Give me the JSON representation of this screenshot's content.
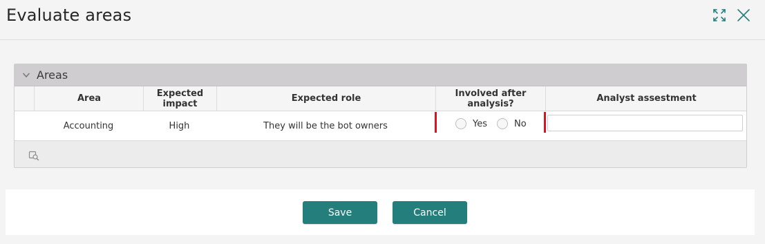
{
  "dialog": {
    "title": "Evaluate areas"
  },
  "panel": {
    "title": "Areas"
  },
  "table": {
    "columns": [
      "Area",
      "Expected impact",
      "Expected role",
      "Involved after analysis?",
      "Analyst assestment"
    ],
    "rows": [
      {
        "area": "Accounting",
        "impact": "High",
        "role": "They will be the bot owners",
        "involved_options": [
          "Yes",
          "No"
        ],
        "involved_selected": null,
        "assessment_value": ""
      }
    ]
  },
  "actions": {
    "save_label": "Save",
    "cancel_label": "Cancel"
  },
  "colors": {
    "accent": "#247e7b",
    "required_marker": "#e0101e",
    "panel_header": "#cfcdcf"
  },
  "icons": {
    "expand": "expand-icon",
    "close": "close-icon",
    "collapse": "chevron-down-icon",
    "table_tool": "search-icon"
  }
}
